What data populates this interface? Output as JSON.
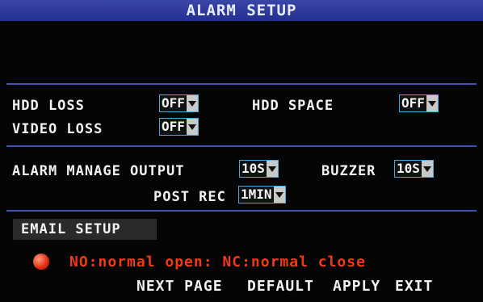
{
  "title": "ALARM SETUP",
  "hdd_loss": {
    "label": "HDD LOSS",
    "value": "OFF"
  },
  "hdd_space": {
    "label": "HDD SPACE",
    "value": "OFF"
  },
  "video_loss": {
    "label": "VIDEO LOSS",
    "value": "OFF"
  },
  "alarm_manage_output": {
    "label": "ALARM MANAGE OUTPUT",
    "value": "10S"
  },
  "buzzer": {
    "label": "BUZZER",
    "value": "10S"
  },
  "post_rec": {
    "label": "POST REC",
    "value": "1MIN"
  },
  "email_setup": "EMAIL SETUP",
  "note": "NO:normal open: NC:normal close",
  "colors": {
    "title_bar": "#2c389a",
    "separator": "#3e4fb8",
    "note": "#f03a14",
    "dropdown_border": "#49a6d8"
  },
  "buttons": {
    "next_page": "NEXT PAGE",
    "default": "DEFAULT",
    "apply": "APPLY",
    "exit": "EXIT"
  }
}
